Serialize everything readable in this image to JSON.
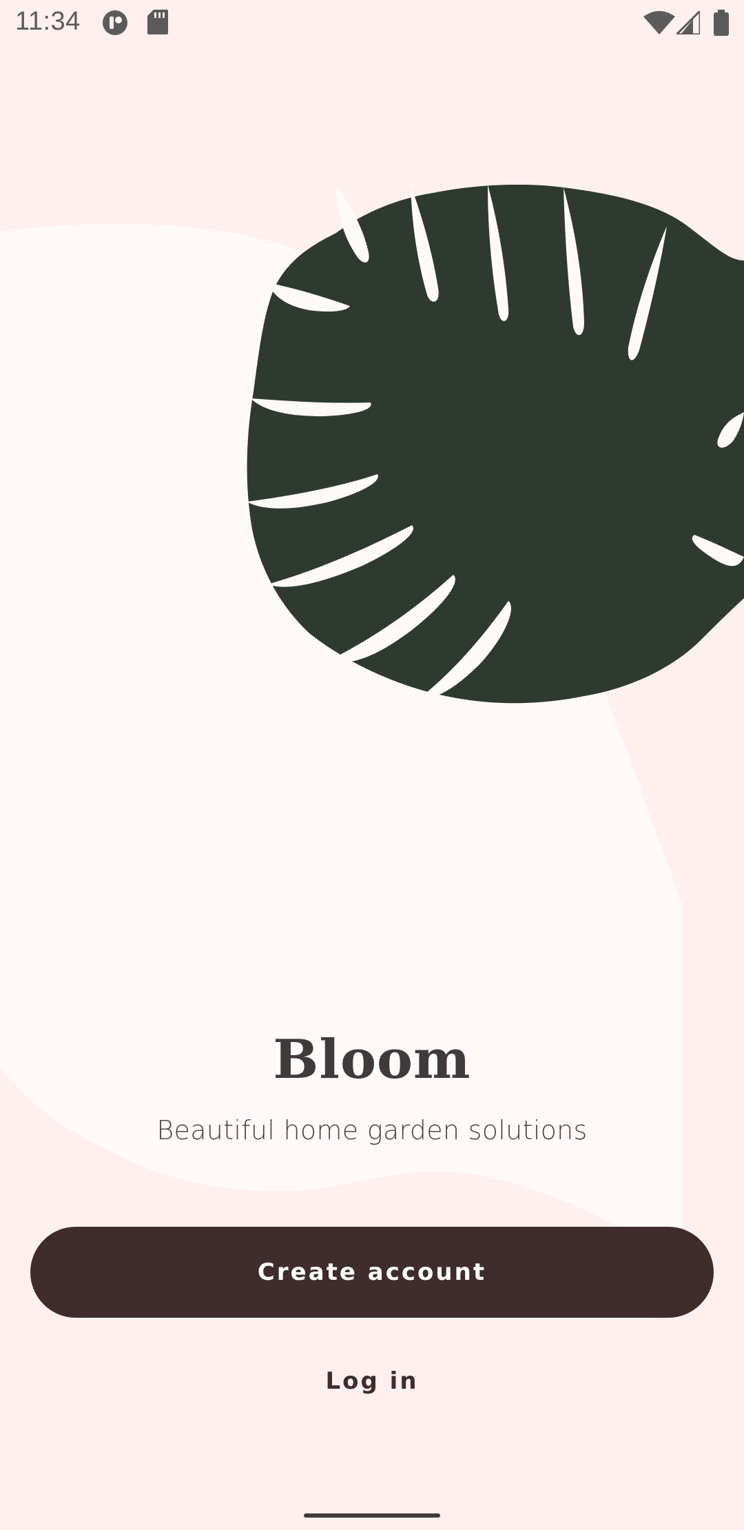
{
  "status_bar": {
    "time": "11:34",
    "left_icons": [
      "notification-app-icon",
      "sd-card-icon"
    ],
    "right_icons": [
      "wifi-icon",
      "cellular-signal-icon",
      "battery-icon"
    ]
  },
  "illustration": {
    "icon": "monstera-leaf-icon",
    "leaf_color": "#2e3a2f"
  },
  "brand": {
    "title": "Bloom",
    "subtitle": "Beautiful home garden solutions"
  },
  "actions": {
    "create_account_label": "Create account",
    "login_label": "Log in"
  },
  "colors": {
    "background": "#FFF0F0",
    "blob": "#FFF9F8",
    "primary_button": "#3f2c2d",
    "text": "#3f3a3b"
  }
}
